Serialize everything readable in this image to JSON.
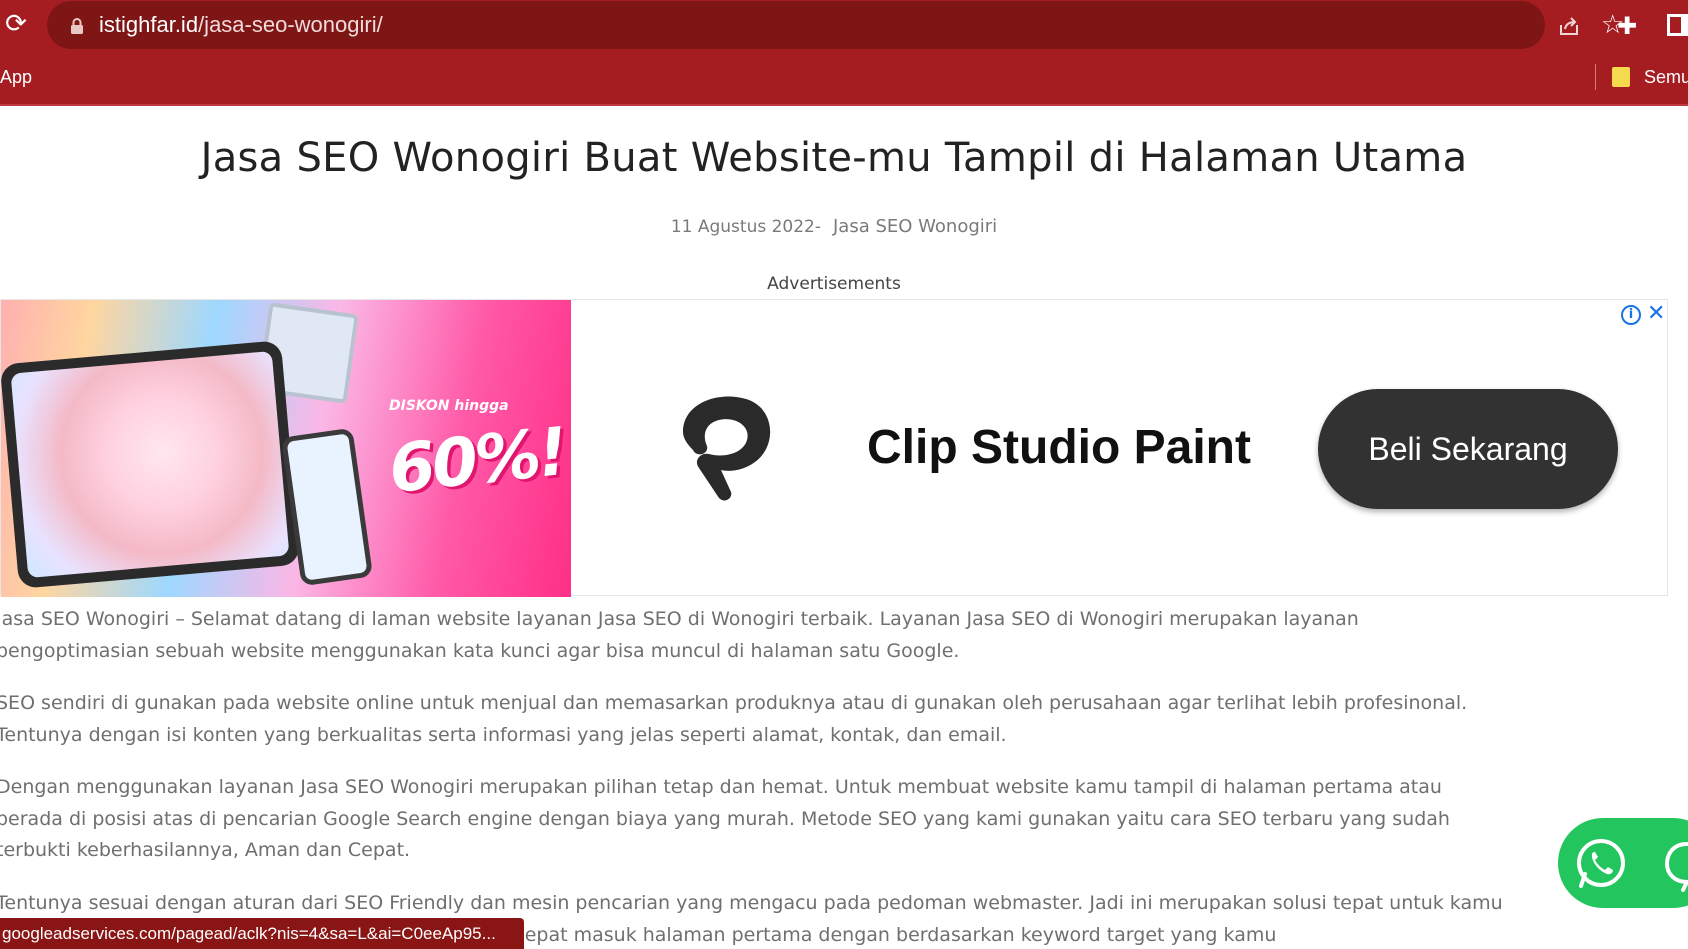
{
  "browser": {
    "url_host": "istighfar.id",
    "url_path": "/jasa-seo-wonogiri/",
    "bookmarks_apps": "App",
    "bookmarks_all": "Semu"
  },
  "article": {
    "title": "Jasa SEO Wonogiri Buat Website-mu Tampil di Halaman Utama",
    "date": "11 Agustus 2022-",
    "category": "Jasa SEO Wonogiri",
    "ad_label": "Advertisements",
    "paragraphs": [
      [
        "Jasa SEO Wonogiri – Selamat datang di laman website layanan Jasa SEO di Wonogiri terbaik. Layanan Jasa SEO  di Wonogiri merupakan layanan",
        "pengoptimasian sebuah website menggunakan kata kunci agar bisa muncul di halaman satu Google."
      ],
      [
        "SEO sendiri di gunakan pada website online untuk menjual dan memasarkan produknya atau di gunakan oleh perusahaan agar terlihat lebih profesinonal.",
        "Tentunya dengan isi konten yang berkualitas serta informasi  yang  jelas seperti alamat, kontak, dan email."
      ],
      [
        "Dengan menggunakan layanan Jasa SEO Wonogiri merupakan pilihan tetap dan hemat. Untuk membuat  website kamu  tampil di halaman pertama atau",
        "berada di posisi atas di pencarian Google Search engine dengan biaya yang murah. Metode SEO yang kami gunakan yaitu cara SEO terbaru yang sudah",
        "terbukti keberhasilannya, Aman dan Cepat."
      ],
      [
        "Tentunya sesuai dengan aturan dari SEO Friendly dan mesin pencarian yang mengacu pada pedoman webmaster. Jadi ini merupakan solusi tepat untuk kamu",
        "agar bagaimana caranya supaya website kamu dapat cepat masuk halaman pertama dengan berdasarkan keyword target yang kamu"
      ]
    ]
  },
  "ad": {
    "promo_small": "DISKON hingga",
    "promo_big": "60%!",
    "brand": "Clip Studio Paint",
    "cta": "Beli Sekarang",
    "info": "i",
    "close": "✕"
  },
  "status_bar": {
    "link": "googleadservices.com/pagead/aclk?nis=4&sa=L&ai=C0eeAp95..."
  },
  "colors": {
    "chrome": "#a51d21",
    "omnibox": "#7e1616",
    "whatsapp": "#22c55e",
    "cta": "#323232",
    "ad_accent": "#1a73e8"
  }
}
